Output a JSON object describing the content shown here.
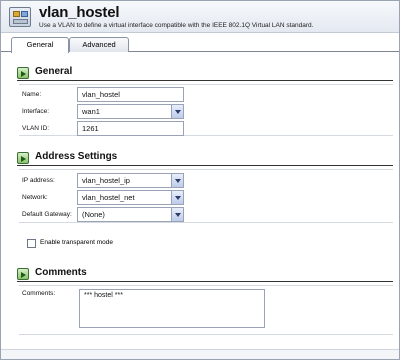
{
  "header": {
    "title": "vlan_hostel",
    "subtitle": "Use a VLAN to define a virtual interface compatible with the IEEE 802.1Q Virtual LAN standard."
  },
  "tabs": [
    {
      "label": "General",
      "active": true
    },
    {
      "label": "Advanced",
      "active": false
    }
  ],
  "sections": {
    "general": {
      "title": "General"
    },
    "address": {
      "title": "Address Settings"
    },
    "comments": {
      "title": "Comments"
    }
  },
  "fields": {
    "name": {
      "label": "Name:",
      "value": "vlan_hostel"
    },
    "interface": {
      "label": "Interface:",
      "value": "wan1"
    },
    "vlan_id": {
      "label": "VLAN ID:",
      "value": "1261"
    },
    "ip_address": {
      "label": "IP address:",
      "value": "vlan_hostel_ip"
    },
    "network": {
      "label": "Network:",
      "value": "vlan_hostel_net"
    },
    "gateway": {
      "label": "Default Gateway:",
      "value": "(None)"
    },
    "transparent": {
      "label": "Enable transparent mode",
      "checked": false
    },
    "comments": {
      "label": "Comments:",
      "value": "*** hostel ***"
    }
  },
  "icons": {
    "header": "vlan-interface-icon",
    "section": "green-arrow-icon"
  }
}
